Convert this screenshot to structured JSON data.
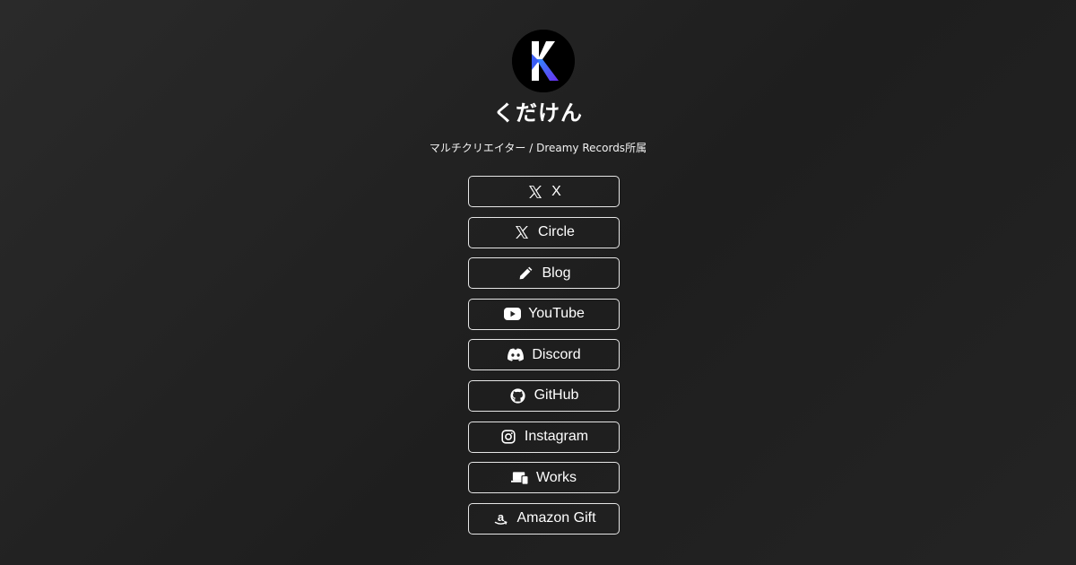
{
  "profile": {
    "name": "くだけん",
    "bio": "マルチクリエイター / Dreamy Records所属"
  },
  "links": [
    {
      "label": "X",
      "icon": "x-logo-icon"
    },
    {
      "label": "Circle",
      "icon": "x-logo-icon"
    },
    {
      "label": "Blog",
      "icon": "pencil-icon"
    },
    {
      "label": "YouTube",
      "icon": "youtube-icon"
    },
    {
      "label": "Discord",
      "icon": "discord-icon"
    },
    {
      "label": "GitHub",
      "icon": "github-icon"
    },
    {
      "label": "Instagram",
      "icon": "instagram-icon"
    },
    {
      "label": "Works",
      "icon": "devices-icon"
    },
    {
      "label": "Amazon Gift",
      "icon": "amazon-icon"
    }
  ],
  "colors": {
    "background": "#222222",
    "text": "#ffffff",
    "border": "#e6e6e6",
    "logo_white": "#ffffff",
    "logo_blue": "#2a6cf0",
    "logo_purple": "#6a2ff0"
  }
}
